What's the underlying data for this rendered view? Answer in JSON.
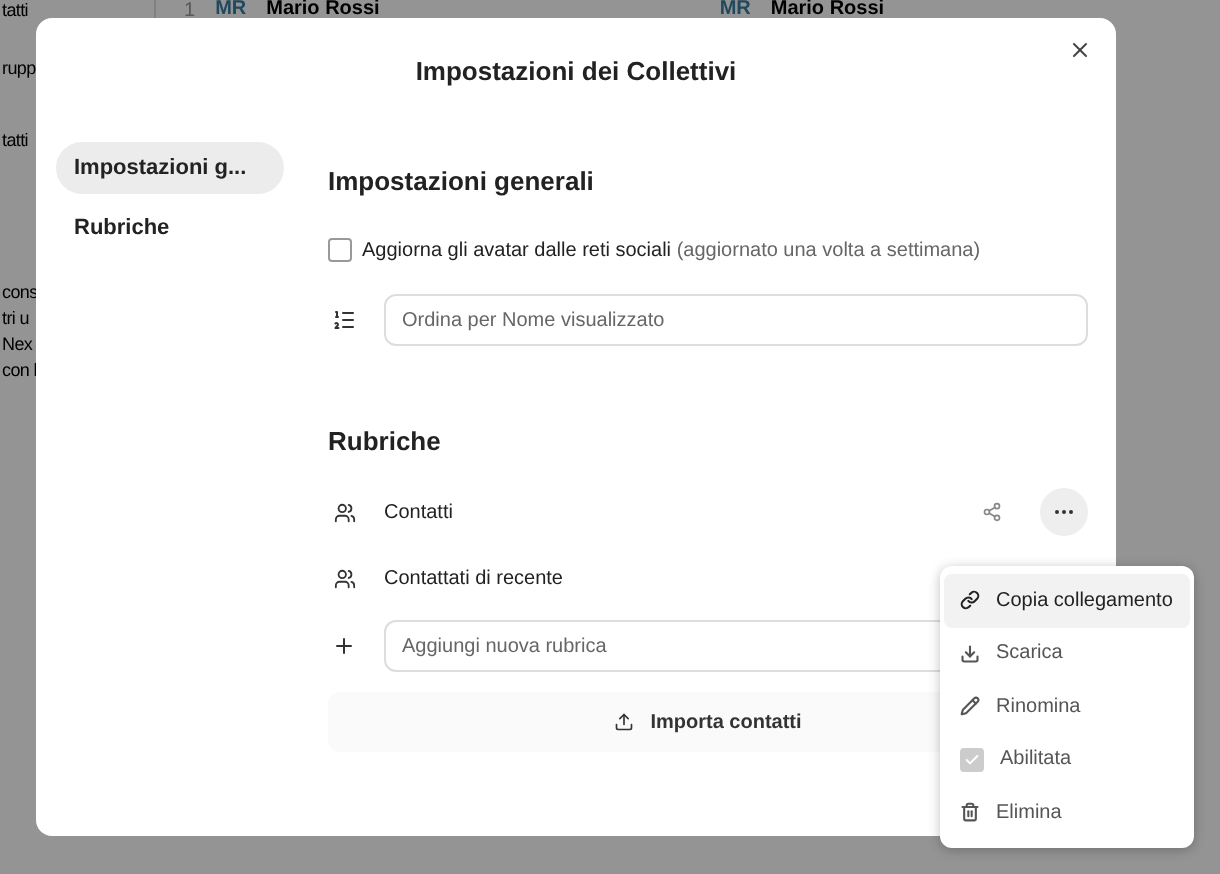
{
  "background": {
    "list_row": {
      "index": "1",
      "avatar": "MR",
      "name": "Mario Rossi"
    },
    "detail": {
      "avatar": "MR",
      "name": "Mario Rossi"
    },
    "sidebar": [
      "tatti",
      "rupp",
      "tatti",
      "cons",
      "tri u",
      "Nex",
      "con l"
    ]
  },
  "dialog": {
    "title": "Impostazioni dei Collettivi",
    "nav": [
      {
        "label": "Impostazioni g...",
        "selected": true
      },
      {
        "label": "Rubriche",
        "selected": false
      }
    ],
    "general": {
      "heading": "Impostazioni generali",
      "checkbox": {
        "label": "Aggiorna gli avatar dalle reti sociali",
        "hint": "(aggiornato una volta a settimana)",
        "checked": false
      },
      "sort_field": {
        "placeholder": "Ordina per Nome visualizzato"
      }
    },
    "addressbooks": {
      "heading": "Rubriche",
      "items": [
        {
          "name": "Contatti",
          "menu_open": true
        },
        {
          "name": "Contattati di recente",
          "menu_open": false
        }
      ],
      "new_field": {
        "placeholder": "Aggiungi nuova rubrica"
      },
      "import_button": "Importa contatti"
    }
  },
  "menu": {
    "items": [
      {
        "kind": "link",
        "label": "Copia collegamento",
        "selected": true
      },
      {
        "kind": "download",
        "label": "Scarica",
        "selected": false
      },
      {
        "kind": "rename",
        "label": "Rinomina",
        "selected": false
      },
      {
        "kind": "checkbox",
        "label": "Abilitata",
        "selected": false,
        "checked": true
      },
      {
        "kind": "delete",
        "label": "Elimina",
        "selected": false
      }
    ]
  }
}
